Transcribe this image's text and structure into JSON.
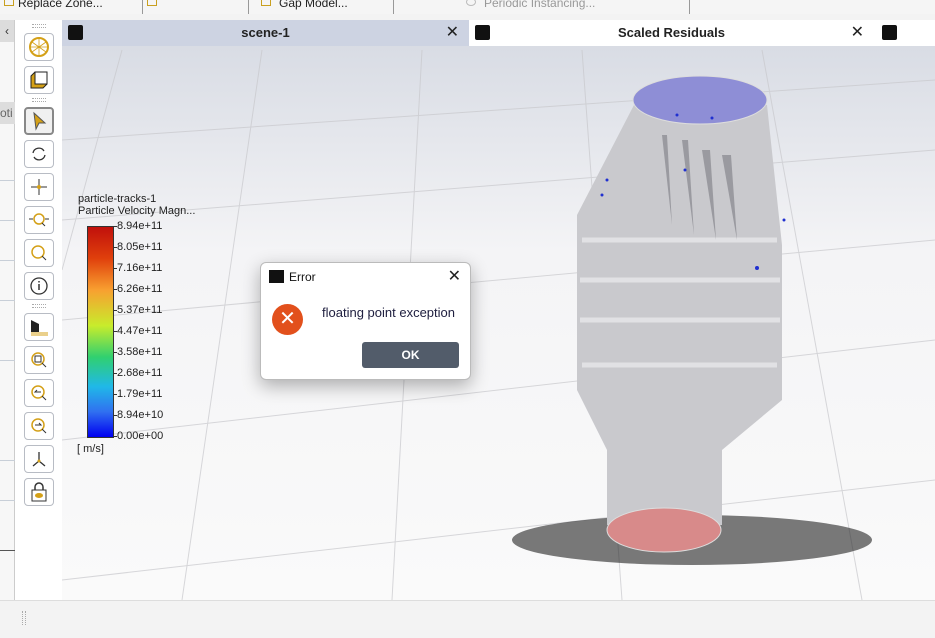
{
  "toolbar": {
    "items": [
      "Replace Zone...",
      "",
      "Gap Model...",
      "Periodic Instancing..."
    ]
  },
  "left_panel": {
    "collapse": "‹",
    "fragment": "oti"
  },
  "tools": [
    {
      "name": "fit-sphere"
    },
    {
      "name": "view-cube"
    },
    {
      "name": "select"
    },
    {
      "name": "rotate"
    },
    {
      "name": "pan"
    },
    {
      "name": "zoom-in-out"
    },
    {
      "name": "zoom"
    },
    {
      "name": "probe-info"
    },
    {
      "name": "pretty-display"
    },
    {
      "name": "zoom-box"
    },
    {
      "name": "previous-view"
    },
    {
      "name": "next-view"
    },
    {
      "name": "axes"
    },
    {
      "name": "lock-view"
    }
  ],
  "tabs": [
    {
      "label": "scene-1",
      "close": "✕"
    },
    {
      "label": "Scaled Residuals",
      "close": "✕"
    }
  ],
  "legend": {
    "title1": "particle-tracks-1",
    "title2": "Particle Velocity Magn...",
    "ticks": [
      "8.94e+11",
      "8.05e+11",
      "7.16e+11",
      "6.26e+11",
      "5.37e+11",
      "4.47e+11",
      "3.58e+11",
      "2.68e+11",
      "1.79e+11",
      "8.94e+10",
      "0.00e+00"
    ],
    "units": "[ m/s]"
  },
  "dialog": {
    "title": "Error",
    "message": "floating point exception",
    "ok": "OK",
    "close": "✕",
    "icon": "✕"
  },
  "colors": {
    "error": "#e2501c",
    "ok_button": "#525c6a",
    "accent": "#d4a017"
  }
}
